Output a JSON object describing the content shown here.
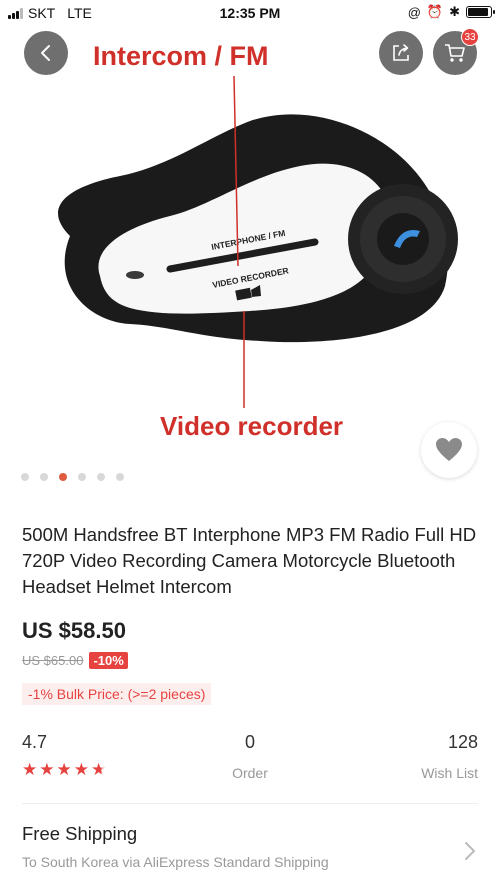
{
  "status_bar": {
    "carrier": "SKT",
    "network": "LTE",
    "time": "12:35 PM",
    "battery_level": 0.95
  },
  "image_area": {
    "annotation_top": "Intercom / FM",
    "annotation_bottom": "Video recorder",
    "device_text_1": "INTERPHONE / FM",
    "device_text_2": "VIDEO RECORDER",
    "cart_count": "33",
    "carousel_count": 6,
    "carousel_active": 2,
    "accent_color": "#e64340"
  },
  "icons": [
    "back-icon",
    "share-icon",
    "cart-icon",
    "heart-icon",
    "chevron-right-icon",
    "phone-icon",
    "camera-icon"
  ],
  "product": {
    "title": "500M Handsfree BT Interphone MP3 FM Radio Full HD 720P Video Recording Camera Motorcycle Bluetooth Headset Helmet Intercom",
    "price": "US $58.50",
    "original_price": "US $65.00",
    "discount": "-10%",
    "bulk_price": "-1% Bulk Price: (>=2 pieces)"
  },
  "stats": {
    "rating": "4.7",
    "rating_stars": 4.7,
    "orders": "0",
    "orders_label": "Order",
    "wishlist": "128",
    "wishlist_label": "Wish List"
  },
  "shipping": {
    "title": "Free Shipping",
    "subtitle": "To South Korea via AliExpress Standard Shipping"
  }
}
